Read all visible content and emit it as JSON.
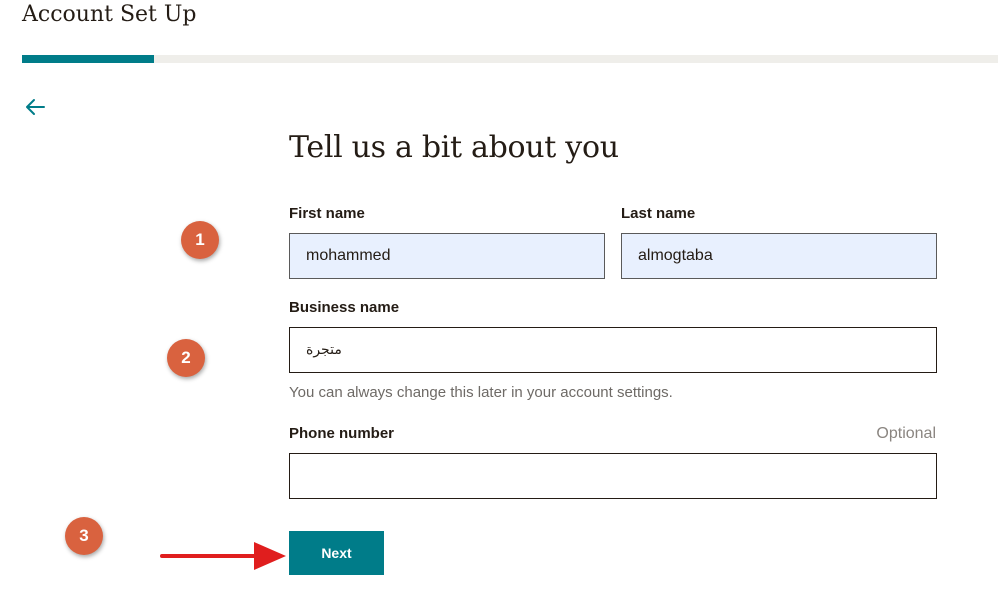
{
  "header": {
    "title": "Account Set Up",
    "progress_fraction": 0.135
  },
  "colors": {
    "accent": "#007c89",
    "badge": "#d9623f",
    "arrow": "#e01e1e",
    "autofill_bg": "#e8f0fe"
  },
  "back": {
    "icon": "arrow-left-icon"
  },
  "form": {
    "heading": "Tell us a bit about you",
    "first_name": {
      "label": "First name",
      "value": "mohammed"
    },
    "last_name": {
      "label": "Last name",
      "value": "almogtaba"
    },
    "business_name": {
      "label": "Business name",
      "value": "متجرة",
      "hint": "You can always change this later in your account settings."
    },
    "phone": {
      "label": "Phone number",
      "optional": "Optional",
      "value": ""
    },
    "next_label": "Next"
  },
  "annotations": {
    "steps": [
      "1",
      "2",
      "3"
    ],
    "arrow_icon": "red-arrow-icon"
  }
}
